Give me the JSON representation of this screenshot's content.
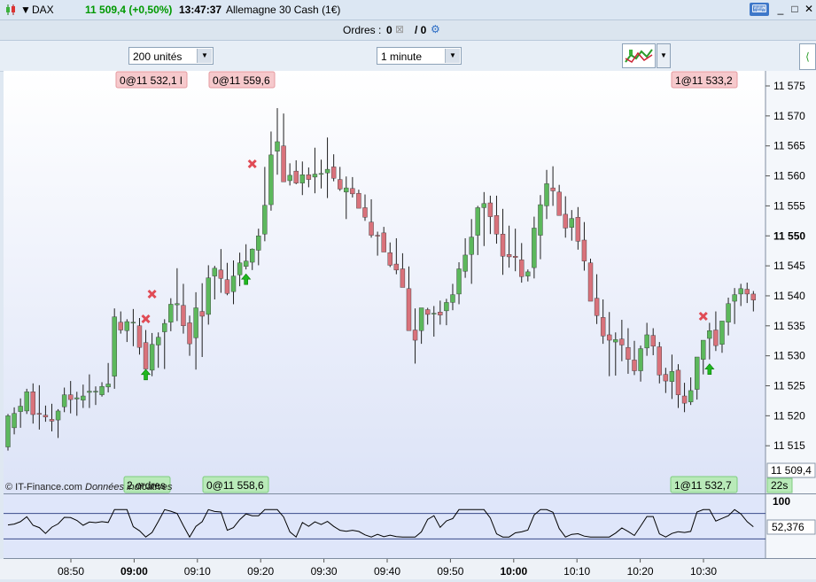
{
  "header": {
    "symbol": "DAX",
    "price": "11 509,4 (+0,50%)",
    "time": "13:47:37",
    "instrument": "Allemagne 30 Cash (1€)",
    "colors": {
      "up": "#009900",
      "title_bg": "#dce7f3"
    }
  },
  "orders_bar": {
    "label": "Ordres :",
    "count_a": "0",
    "count_b": "/ 0"
  },
  "toolbar": {
    "quantity": "200 unités",
    "timeframe": "1 minute"
  },
  "order_tags": {
    "top": [
      "0@11 532,1 l",
      "0@11 559,6",
      "1@11 533,2"
    ],
    "bottom": [
      "2 ordres",
      "0@11 558,6",
      "1@11 532,7"
    ]
  },
  "footer": {
    "copyright": "© IT-Finance.com",
    "data_note": "Données indicatives",
    "countdown": "22s"
  },
  "chart_data": {
    "type": "candlestick",
    "timeframe": "1 minute",
    "ylim": [
      11511,
      11578
    ],
    "y_ticks": [
      11575,
      11570,
      11565,
      11560,
      11555,
      11550,
      11545,
      11540,
      11535,
      11530,
      11525,
      11520,
      11515
    ],
    "y_tick_labels": [
      "11 575",
      "11 570",
      "11 565",
      "11 560",
      "11 555",
      "11 550",
      "11 545",
      "11 540",
      "11 535",
      "11 530",
      "11 525",
      "11 520",
      "11 515"
    ],
    "bold_tick": 11550,
    "x_tick_labels": [
      "08:50",
      "09:00",
      "09:10",
      "09:20",
      "09:30",
      "09:40",
      "09:50",
      "10:00",
      "10:10",
      "10:20",
      "10:30"
    ],
    "bold_x_ticks": [
      "09:00",
      "10:00"
    ],
    "last_price_label": "11 509,4",
    "candles": [
      [
        11514.8,
        11520.3,
        11514.2,
        11520.0
      ],
      [
        11518.0,
        11521.4,
        11516.9,
        11520.4
      ],
      [
        11520.7,
        11522.9,
        11518.0,
        11521.6
      ],
      [
        11520.8,
        11524.5,
        11520.3,
        11524.0
      ],
      [
        11524.0,
        11525.4,
        11518.7,
        11520.2
      ],
      [
        11520.4,
        11525.1,
        11517.7,
        11520.3
      ],
      [
        11520.1,
        11521.7,
        11519.0,
        11519.8
      ],
      [
        11519.4,
        11522.0,
        11517.4,
        11519.1
      ],
      [
        11519.3,
        11521.1,
        11516.3,
        11520.8
      ],
      [
        11521.5,
        11524.7,
        11520.6,
        11523.5
      ],
      [
        11523.5,
        11525.8,
        11520.4,
        11522.7
      ],
      [
        11522.8,
        11524.0,
        11520.0,
        11523.0
      ],
      [
        11522.6,
        11525.2,
        11521.3,
        11523.3
      ],
      [
        11523.9,
        11526.9,
        11521.3,
        11524.1
      ],
      [
        11524.1,
        11524.9,
        11521.8,
        11524.1
      ],
      [
        11523.5,
        11525.6,
        11523.2,
        11524.9
      ],
      [
        11524.8,
        11528.8,
        11523.9,
        11525.3
      ],
      [
        11526.6,
        11537.9,
        11524.5,
        11536.5
      ],
      [
        11535.6,
        11537.4,
        11533.7,
        11534.3
      ],
      [
        11534.2,
        11536.1,
        11532.3,
        11535.7
      ],
      [
        11535.6,
        11537.8,
        11531.6,
        11535.6
      ],
      [
        11535.0,
        11536.3,
        11530.2,
        11531.4
      ],
      [
        11532.2,
        11534.3,
        11528.5,
        11527.8
      ],
      [
        11527.6,
        11533.8,
        11526.6,
        11531.9
      ],
      [
        11531.8,
        11533.9,
        11528.0,
        11533.1
      ],
      [
        11534.0,
        11536.1,
        11527.8,
        11535.4
      ],
      [
        11535.6,
        11539.6,
        11534.1,
        11538.6
      ],
      [
        11538.5,
        11544.6,
        11535.8,
        11538.7
      ],
      [
        11538.4,
        11542.0,
        11533.7,
        11535.0
      ],
      [
        11535.5,
        11536.7,
        11530.0,
        11532.0
      ],
      [
        11533.0,
        11540.6,
        11527.7,
        11538.0
      ],
      [
        11537.4,
        11542.1,
        11529.8,
        11536.6
      ],
      [
        11536.9,
        11545.1,
        11535.2,
        11543.0
      ],
      [
        11543.3,
        11545.0,
        11539.4,
        11544.6
      ],
      [
        11544.3,
        11547.8,
        11540.5,
        11542.9
      ],
      [
        11542.7,
        11545.5,
        11540.1,
        11540.4
      ],
      [
        11540.7,
        11545.9,
        11538.6,
        11543.3
      ],
      [
        11543.5,
        11547.2,
        11541.6,
        11545.5
      ],
      [
        11544.9,
        11548.6,
        11544.4,
        11545.8
      ],
      [
        11545.6,
        11547.9,
        11544.3,
        11547.8
      ],
      [
        11547.6,
        11551.2,
        11545.1,
        11550.0
      ],
      [
        11550.3,
        11561.5,
        11549.1,
        11555.1
      ],
      [
        11555.2,
        11567.4,
        11554.2,
        11563.5
      ],
      [
        11564.1,
        11571.3,
        11560.2,
        11565.7
      ],
      [
        11565.0,
        11570.4,
        11559.4,
        11559.0
      ],
      [
        11559.2,
        11562.1,
        11558.4,
        11560.1
      ],
      [
        11560.8,
        11562.6,
        11558.6,
        11558.8
      ],
      [
        11558.8,
        11562.4,
        11556.8,
        11560.2
      ],
      [
        11560.2,
        11561.4,
        11558.1,
        11559.4
      ],
      [
        11559.8,
        11564.7,
        11557.1,
        11560.3
      ],
      [
        11560.3,
        11562.7,
        11557.9,
        11560.4
      ],
      [
        11560.5,
        11566.4,
        11556.3,
        11561.1
      ],
      [
        11561.5,
        11563.6,
        11559.1,
        11559.6
      ],
      [
        11559.4,
        11561.5,
        11557.5,
        11557.8
      ],
      [
        11557.3,
        11559.9,
        11552.8,
        11558.0
      ],
      [
        11557.9,
        11559.8,
        11556.4,
        11557.0
      ],
      [
        11557.1,
        11557.7,
        11555.0,
        11554.6
      ],
      [
        11554.7,
        11556.9,
        11552.5,
        11553.1
      ],
      [
        11552.3,
        11556.1,
        11549.7,
        11550.1
      ],
      [
        11550.1,
        11550.7,
        11546.7,
        11550.0
      ],
      [
        11550.5,
        11551.5,
        11547.9,
        11547.3
      ],
      [
        11547.2,
        11548.9,
        11544.8,
        11545.1
      ],
      [
        11545.3,
        11549.6,
        11543.6,
        11544.3
      ],
      [
        11544.5,
        11547.1,
        11541.6,
        11541.4
      ],
      [
        11541.2,
        11544.9,
        11534.5,
        11534.2
      ],
      [
        11534.3,
        11537.9,
        11528.7,
        11532.6
      ],
      [
        11534.2,
        11537.0,
        11532.0,
        11538.0
      ],
      [
        11537.7,
        11538.0,
        11535.2,
        11536.9
      ],
      [
        11537.0,
        11538.3,
        11533.2,
        11537.1
      ],
      [
        11537.3,
        11539.2,
        11535.2,
        11536.8
      ],
      [
        11537.5,
        11539.5,
        11535.1,
        11538.9
      ],
      [
        11538.9,
        11542.0,
        11537.6,
        11540.2
      ],
      [
        11540.3,
        11545.6,
        11538.6,
        11544.5
      ],
      [
        11544.1,
        11549.6,
        11543.0,
        11546.8
      ],
      [
        11546.9,
        11552.8,
        11542.0,
        11549.8
      ],
      [
        11550.1,
        11555.0,
        11546.8,
        11554.7
      ],
      [
        11554.7,
        11557.3,
        11548.3,
        11555.4
      ],
      [
        11555.5,
        11556.7,
        11550.3,
        11553.2
      ],
      [
        11553.4,
        11556.7,
        11548.7,
        11550.3
      ],
      [
        11550.3,
        11554.5,
        11543.5,
        11546.6
      ],
      [
        11546.9,
        11551.7,
        11544.7,
        11546.5
      ],
      [
        11546.6,
        11551.2,
        11544.1,
        11546.4
      ],
      [
        11546.0,
        11548.8,
        11542.2,
        11543.2
      ],
      [
        11543.3,
        11544.4,
        11542.4,
        11544.0
      ],
      [
        11544.7,
        11553.2,
        11542.9,
        11551.3
      ],
      [
        11550.1,
        11556.8,
        11546.1,
        11555.2
      ],
      [
        11555.0,
        11561.0,
        11552.8,
        11558.7
      ],
      [
        11558.0,
        11561.6,
        11555.0,
        11557.5
      ],
      [
        11557.3,
        11558.5,
        11554.7,
        11553.4
      ],
      [
        11553.6,
        11556.6,
        11549.7,
        11551.3
      ],
      [
        11551.4,
        11554.3,
        11549.2,
        11552.9
      ],
      [
        11553.1,
        11554.8,
        11547.7,
        11549.1
      ],
      [
        11549.3,
        11552.3,
        11544.2,
        11545.8
      ],
      [
        11545.5,
        11546.2,
        11540.6,
        11539.1
      ],
      [
        11539.6,
        11543.6,
        11535.3,
        11536.7
      ],
      [
        11536.4,
        11539.4,
        11532.0,
        11533.3
      ],
      [
        11533.5,
        11537.3,
        11526.6,
        11532.6
      ],
      [
        11532.3,
        11533.9,
        11526.7,
        11532.7
      ],
      [
        11532.8,
        11536.0,
        11529.1,
        11531.8
      ],
      [
        11531.4,
        11534.6,
        11527.0,
        11529.4
      ],
      [
        11529.3,
        11532.5,
        11526.8,
        11527.5
      ],
      [
        11527.5,
        11531.7,
        11525.7,
        11531.2
      ],
      [
        11531.3,
        11535.5,
        11530.0,
        11533.5
      ],
      [
        11533.4,
        11534.6,
        11530.1,
        11531.6
      ],
      [
        11531.5,
        11532.3,
        11525.4,
        11526.8
      ],
      [
        11526.9,
        11528.0,
        11523.8,
        11525.8
      ],
      [
        11525.7,
        11530.2,
        11522.8,
        11527.4
      ],
      [
        11527.6,
        11528.6,
        11521.3,
        11523.5
      ],
      [
        11523.3,
        11525.5,
        11520.6,
        11522.1
      ],
      [
        11522.3,
        11526.4,
        11521.8,
        11524.2
      ],
      [
        11524.4,
        11529.2,
        11522.7,
        11529.8
      ],
      [
        11529.4,
        11530.9,
        11526.9,
        11532.6
      ],
      [
        11532.9,
        11535.5,
        11529.4,
        11534.2
      ],
      [
        11534.3,
        11537.4,
        11530.8,
        11531.7
      ],
      [
        11531.9,
        11535.6,
        11530.5,
        11535.8
      ],
      [
        11535.6,
        11539.7,
        11533.4,
        11538.7
      ],
      [
        11539.1,
        11541.3,
        11535.3,
        11540.2
      ],
      [
        11540.3,
        11542.0,
        11538.3,
        11541.2
      ],
      [
        11541.1,
        11542.2,
        11538.8,
        11540.3
      ],
      [
        11540.3,
        11540.8,
        11537.4,
        11539.3
      ]
    ],
    "up_color": "#5cb85c",
    "down_color": "#d9727b",
    "buy_markers": [
      22,
      38,
      112
    ],
    "exit_markers": [
      22,
      23,
      39,
      111
    ],
    "oscillator": {
      "label": "100",
      "value_label": "52,376",
      "upper_level": 70,
      "lower_level": 30,
      "line_color": "#000000"
    }
  }
}
